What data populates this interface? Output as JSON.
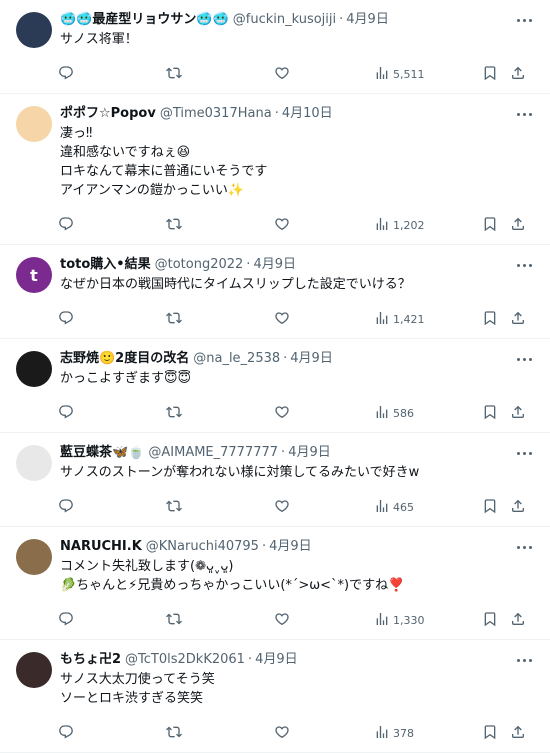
{
  "tweets": [
    {
      "name": "🥶🥶最産型リョウサン🥶🥶",
      "handle": "@fuckin_kusojiji",
      "time": "4月9日",
      "lines": [
        "サノス将軍！"
      ],
      "views": "5,511",
      "avatar_color": "#2b3a55"
    },
    {
      "name": "ポポフ☆Popov",
      "handle": "@Time0317Hana",
      "time": "4月10日",
      "lines": [
        "凄っ‼",
        "違和感ないですねぇ😆",
        "ロキなんて幕末に普通にいそうです",
        "アイアンマンの鎧かっこいい✨"
      ],
      "views": "1,202",
      "avatar_color": "#f6d6a8"
    },
    {
      "name": "toto購入•結果",
      "handle": "@totong2022",
      "time": "4月9日",
      "lines": [
        "なぜか日本の戦国時代にタイムスリップした設定でいける？"
      ],
      "views": "1,421",
      "avatar_color": "#7b2a8f",
      "avatar_letter": "t"
    },
    {
      "name": "志野焼🙂2度目の改名",
      "handle": "@na_le_2538",
      "time": "4月9日",
      "lines": [
        "かっこよすぎます😇😇"
      ],
      "views": "586",
      "avatar_color": "#1a1a1a"
    },
    {
      "name": "藍豆蝶茶🦋🍵",
      "handle": "@AIMAME_7777777",
      "time": "4月9日",
      "lines": [
        "サノスのストーンが奪われない様に対策してるみたいで好きw"
      ],
      "views": "465",
      "avatar_color": "#e8e8e8"
    },
    {
      "name": "NARUCHI.K",
      "handle": "@KNaruchi40795",
      "time": "4月9日",
      "lines": [
        "コメント失礼致します(❁ᴗ͈ˬᴗ͈)",
        "🥬ちゃんと⚡兄貴めっちゃかっこいい(*´>ω<`*)ですね❣️"
      ],
      "views": "1,330",
      "avatar_color": "#8a6d4a"
    },
    {
      "name": "もちょ卍2",
      "handle": "@TcT0ls2DkK2061",
      "time": "4月9日",
      "lines": [
        "サノス大太刀使ってそう笑",
        "ソーとロキ渋すぎる笑笑"
      ],
      "views": "378",
      "avatar_color": "#3a2a2a"
    }
  ]
}
